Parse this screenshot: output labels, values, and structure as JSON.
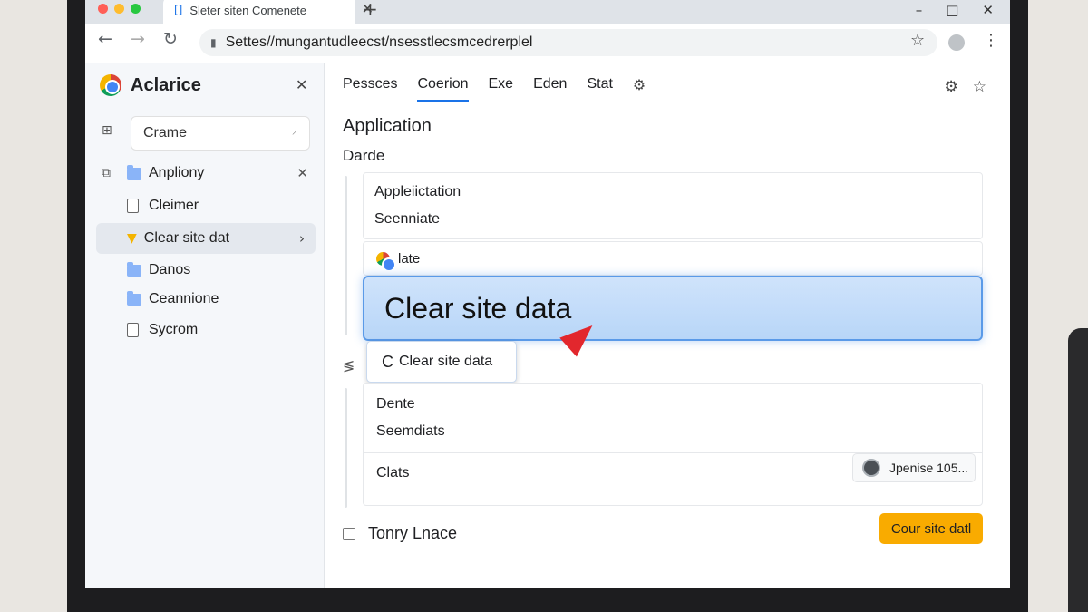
{
  "window": {
    "tab_title": "Sleter siten Comenete",
    "tab_favicon": "bracket-icon",
    "new_tab_glyph": "+",
    "controls": [
      "–",
      "□",
      "✕"
    ],
    "traffic_lights": [
      "#ff5f57",
      "#febc2e",
      "#28c840"
    ]
  },
  "toolbar": {
    "url": "Settes//mungantudleecst/nsesstlecsmcedrerplel",
    "back_glyph": "←",
    "forward_glyph": "→",
    "reload_glyph": "↻",
    "lock_glyph": "🔒",
    "star_glyph": "☆",
    "menu_glyph": "⋮"
  },
  "sidebar": {
    "title": "Aclarice",
    "close_glyph": "✕",
    "search_value": "Crame",
    "items": [
      {
        "label": "Anpliony",
        "icon": "folder-icon"
      },
      {
        "label": "Cleimer",
        "icon": "document-icon"
      },
      {
        "label": "Clear site dat",
        "icon": "cup-icon",
        "active": true
      },
      {
        "label": "Danos",
        "icon": "folder-icon"
      },
      {
        "label": "Ceannione",
        "icon": "folder-icon"
      },
      {
        "label": "Sycrom",
        "icon": "document-icon"
      }
    ]
  },
  "main": {
    "tabs": [
      "Pessces",
      "Coerion",
      "Exe",
      "Eden",
      "Stat"
    ],
    "active_tab": "Coerion",
    "heading": "Application",
    "subheading": "Darde",
    "group1": [
      "Appleiictation",
      "Seenniate"
    ],
    "item_late": "late",
    "big_button": "Clear site data",
    "chip_button": "Clear site data",
    "chip_glyph": "C",
    "group2": [
      "Dente",
      "Seemdiats"
    ],
    "clats_label": "Clats",
    "user_chip": "Jpenise 105...",
    "footer_label": "Tonry Lnace",
    "primary_button": "Cour site datl",
    "accent_color": "#1a73e8",
    "primary_color": "#f9ab00"
  }
}
